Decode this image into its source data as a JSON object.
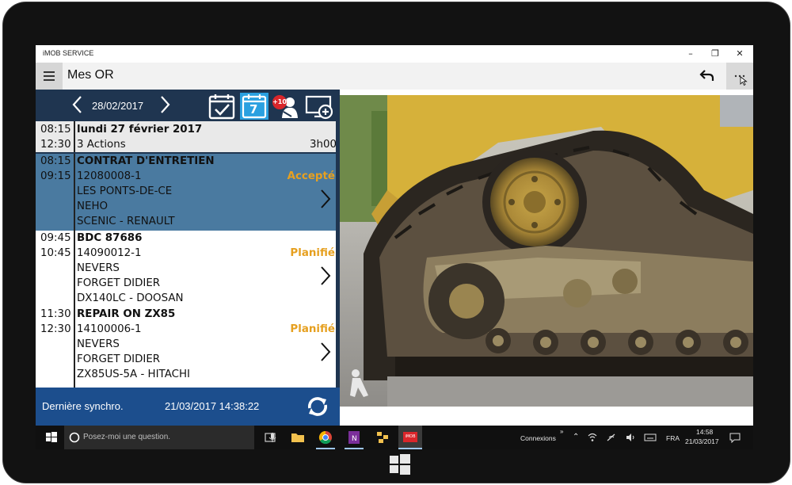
{
  "window": {
    "app_title": "iMOB SERVICE",
    "minimize": "–",
    "restore": "❐",
    "close": "✕"
  },
  "header": {
    "page_title": "Mes OR"
  },
  "datebar": {
    "current_date": "28/02/2017",
    "calendar_day": "7",
    "badge": "+10"
  },
  "day_summary": {
    "start": "08:15",
    "end": "12:30",
    "title": "lundi 27 février 2017",
    "actions": "3 Actions",
    "duration": "3h00"
  },
  "interventions": [
    {
      "start": "08:15",
      "end": "09:15",
      "title": "CONTRAT D'ENTRETIEN",
      "ref": "12080008-1",
      "city": "LES PONTS-DE-CE",
      "client": "NEHO",
      "machine": "SCENIC - RENAULT",
      "status": "Accepté",
      "selected": true
    },
    {
      "start": "09:45",
      "end": "10:45",
      "title": "BDC 87686",
      "ref": "14090012-1",
      "city": "NEVERS",
      "client": "FORGET DIDIER",
      "machine": "DX140LC - DOOSAN",
      "status": "Planifié",
      "selected": false
    },
    {
      "start": "11:30",
      "end": "12:30",
      "title": "REPAIR ON ZX85",
      "ref": "14100006-1",
      "city": "NEVERS",
      "client": "FORGET DIDIER",
      "machine": "ZX85US-5A - HITACHI",
      "status": "Planifié",
      "selected": false
    }
  ],
  "sync": {
    "label": "Dernière synchro.",
    "timestamp": "21/03/2017 14:38:22"
  },
  "taskbar": {
    "search_placeholder": "Posez-moi une question.",
    "connexions": "Connexions",
    "language": "FRA",
    "time": "14:58",
    "date": "21/03/2017",
    "imob_label": "iMOB"
  },
  "colors": {
    "datebar_bg": "#1f3550",
    "selected_row_bg": "#4a7aa0",
    "sync_bar_bg": "#1c4e8d",
    "status_color": "#e6a020",
    "calendar_accent": "#2aa0e0"
  }
}
